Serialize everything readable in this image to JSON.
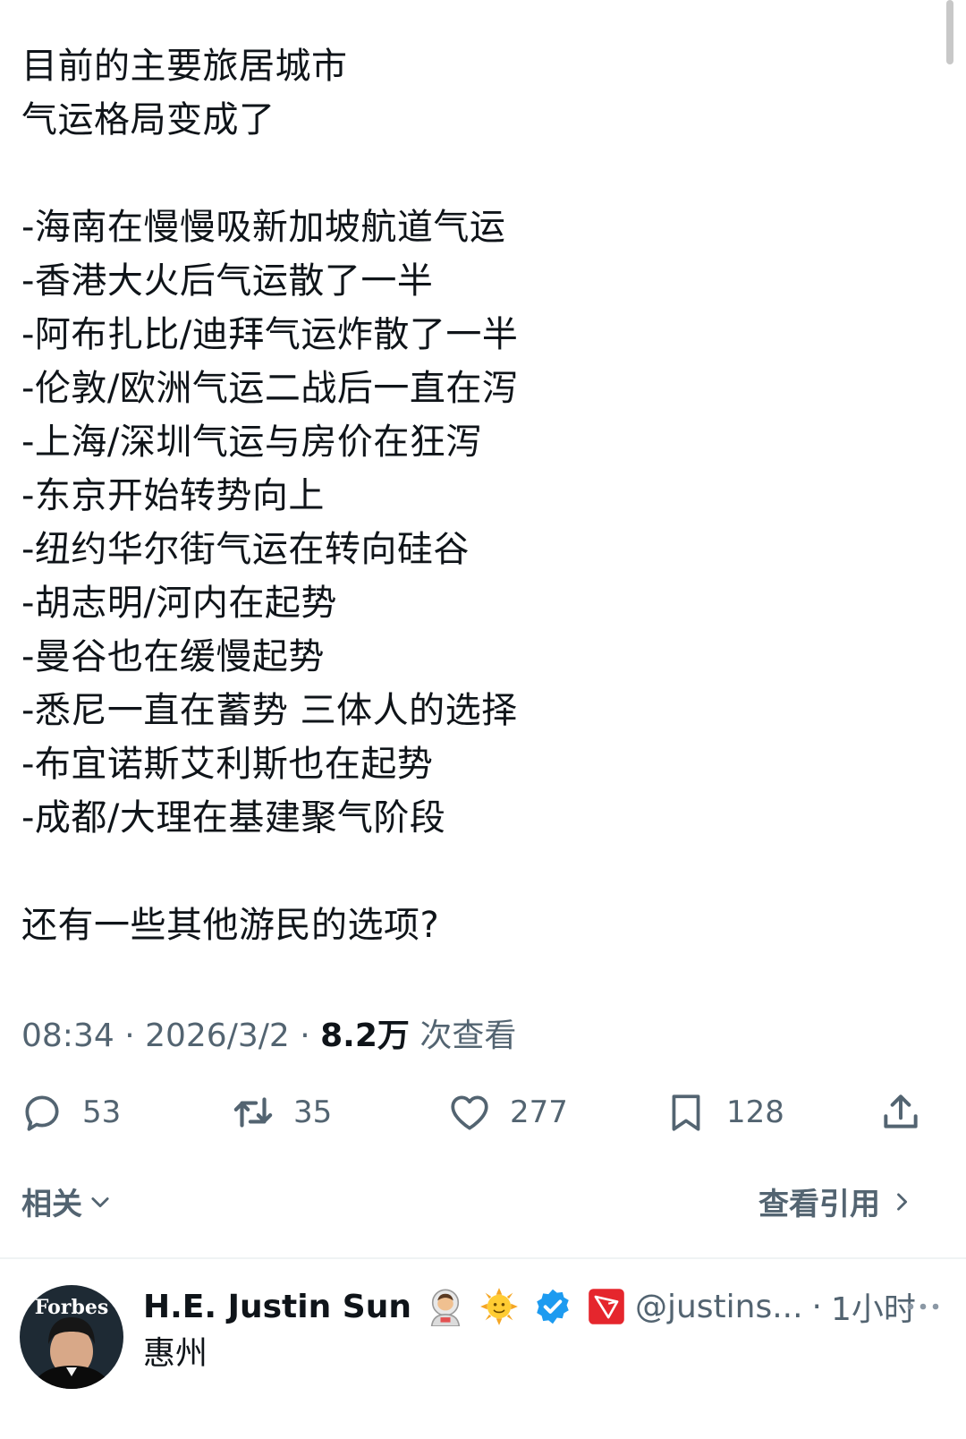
{
  "tweet": {
    "lines": [
      "目前的主要旅居城市",
      "气运格局变成了",
      "",
      "-海南在慢慢吸新加坡航道气运",
      "-香港大火后气运散了一半",
      "-阿布扎比/迪拜气运炸散了一半",
      "-伦敦/欧洲气运二战后一直在泻",
      "-上海/深圳气运与房价在狂泻",
      "-东京开始转势向上",
      "-纽约华尔街气运在转向硅谷",
      "-胡志明/河内在起势",
      "-曼谷也在缓慢起势",
      "-悉尼一直在蓄势 三体人的选择",
      "-布宜诺斯艾利斯也在起势",
      "-成都/大理在基建聚气阶段",
      "",
      "还有一些其他游民的选项?"
    ],
    "time": "08:34",
    "date": "2026/3/2",
    "views_count": "8.2万",
    "views_label": "次查看"
  },
  "actions": {
    "replies": "53",
    "retweets": "35",
    "likes": "277",
    "bookmarks": "128"
  },
  "related": {
    "label": "相关"
  },
  "quotes": {
    "label": "查看引用"
  },
  "reply": {
    "name": "H.E. Justin Sun",
    "handle": "@justins...",
    "time_ago": "1小时",
    "text": "惠州",
    "avatar_text": "Forbes"
  },
  "colors": {
    "text": "#0f1419",
    "secondary": "#536471",
    "verified": "#1d9bf0",
    "tron_red": "#e5262d"
  }
}
